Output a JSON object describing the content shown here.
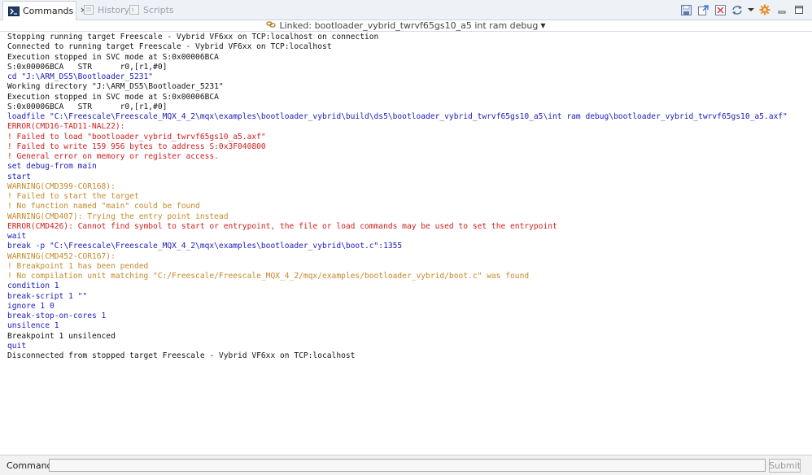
{
  "tabs": [
    {
      "label": "Commands",
      "active": true,
      "icon": "terminal-icon"
    },
    {
      "label": "History",
      "active": false,
      "icon": "history-icon"
    },
    {
      "label": "Scripts",
      "active": false,
      "icon": "scripts-icon"
    }
  ],
  "link": {
    "label": "Linked: bootloader_vybrid_twrvf65gs10_a5 int ram debug",
    "icon": "link-icon"
  },
  "toolbar": {
    "icons": [
      "save-icon",
      "export-icon",
      "clear-console-icon",
      "sync-icon",
      "menu-dropdown-icon",
      "settings-icon",
      "minimize-icon",
      "maximize-icon"
    ]
  },
  "colors": {
    "command": "#1b1bbd",
    "error": "#d12020",
    "warning": "#c48a2a",
    "info": "#141414"
  },
  "console_lines": [
    {
      "text": "Stopping running target Freescale - Vybrid VF6xx on TCP:localhost on connection",
      "type": "info"
    },
    {
      "text": "Connected to running target Freescale - Vybrid VF6xx on TCP:localhost",
      "type": "info"
    },
    {
      "text": "Execution stopped in SVC mode at S:0x00006BCA",
      "type": "info"
    },
    {
      "text": "S:0x00006BCA   STR      r0,[r1,#0]",
      "type": "info"
    },
    {
      "text": "cd \"J:\\ARM_DS5\\Bootloader_5231\"",
      "type": "cmd"
    },
    {
      "text": "Working directory \"J:\\ARM_DS5\\Bootloader_5231\"",
      "type": "info"
    },
    {
      "text": "Execution stopped in SVC mode at S:0x00006BCA",
      "type": "info"
    },
    {
      "text": "S:0x00006BCA   STR      r0,[r1,#0]",
      "type": "info"
    },
    {
      "text": "loadfile \"C:\\Freescale\\Freescale_MQX_4_2\\mqx\\examples\\bootloader_vybrid\\build\\ds5\\bootloader_vybrid_twrvf65gs10_a5\\int ram debug\\bootloader_vybrid_twrvf65gs10_a5.axf\"",
      "type": "cmd"
    },
    {
      "text": "ERROR(CMD16-TAD11-NAL22):",
      "type": "err"
    },
    {
      "text": "! Failed to load \"bootloader_vybrid_twrvf65gs10_a5.axf\"",
      "type": "err"
    },
    {
      "text": "! Failed to write 159 956 bytes to address S:0x3F040800",
      "type": "err"
    },
    {
      "text": "! General error on memory or register access.",
      "type": "err"
    },
    {
      "text": "set debug-from main",
      "type": "cmd"
    },
    {
      "text": "start",
      "type": "cmd"
    },
    {
      "text": "WARNING(CMD399-COR168):",
      "type": "warn"
    },
    {
      "text": "! Failed to start the target",
      "type": "warn"
    },
    {
      "text": "! No function named \"main\" could be found",
      "type": "warn"
    },
    {
      "text": "WARNING(CMD407): Trying the entry point instead",
      "type": "warn"
    },
    {
      "text": "ERROR(CMD426): Cannot find symbol to start or entrypoint, the file or load commands may be used to set the entrypoint",
      "type": "err"
    },
    {
      "text": "wait",
      "type": "cmd"
    },
    {
      "text": "break -p \"C:\\Freescale\\Freescale_MQX_4_2\\mqx\\examples\\bootloader_vybrid\\boot.c\":1355",
      "type": "cmd"
    },
    {
      "text": "WARNING(CMD452-COR167):",
      "type": "warn"
    },
    {
      "text": "! Breakpoint 1 has been pended",
      "type": "warn"
    },
    {
      "text": "! No compilation unit matching \"C:/Freescale/Freescale_MQX_4_2/mqx/examples/bootloader_vybrid/boot.c\" was found",
      "type": "warn"
    },
    {
      "text": "condition 1",
      "type": "cmd"
    },
    {
      "text": "break-script 1 \"\"",
      "type": "cmd"
    },
    {
      "text": "ignore 1 0",
      "type": "cmd"
    },
    {
      "text": "break-stop-on-cores 1",
      "type": "cmd"
    },
    {
      "text": "unsilence 1",
      "type": "cmd"
    },
    {
      "text": "Breakpoint 1 unsilenced",
      "type": "info"
    },
    {
      "text": "quit",
      "type": "cmd"
    },
    {
      "text": "Disconnected from stopped target Freescale - Vybrid VF6xx on TCP:localhost",
      "type": "info"
    }
  ],
  "command_bar": {
    "label": "Command:",
    "value": "",
    "placeholder": "",
    "submit_label": "Submit",
    "submit_enabled": false
  }
}
